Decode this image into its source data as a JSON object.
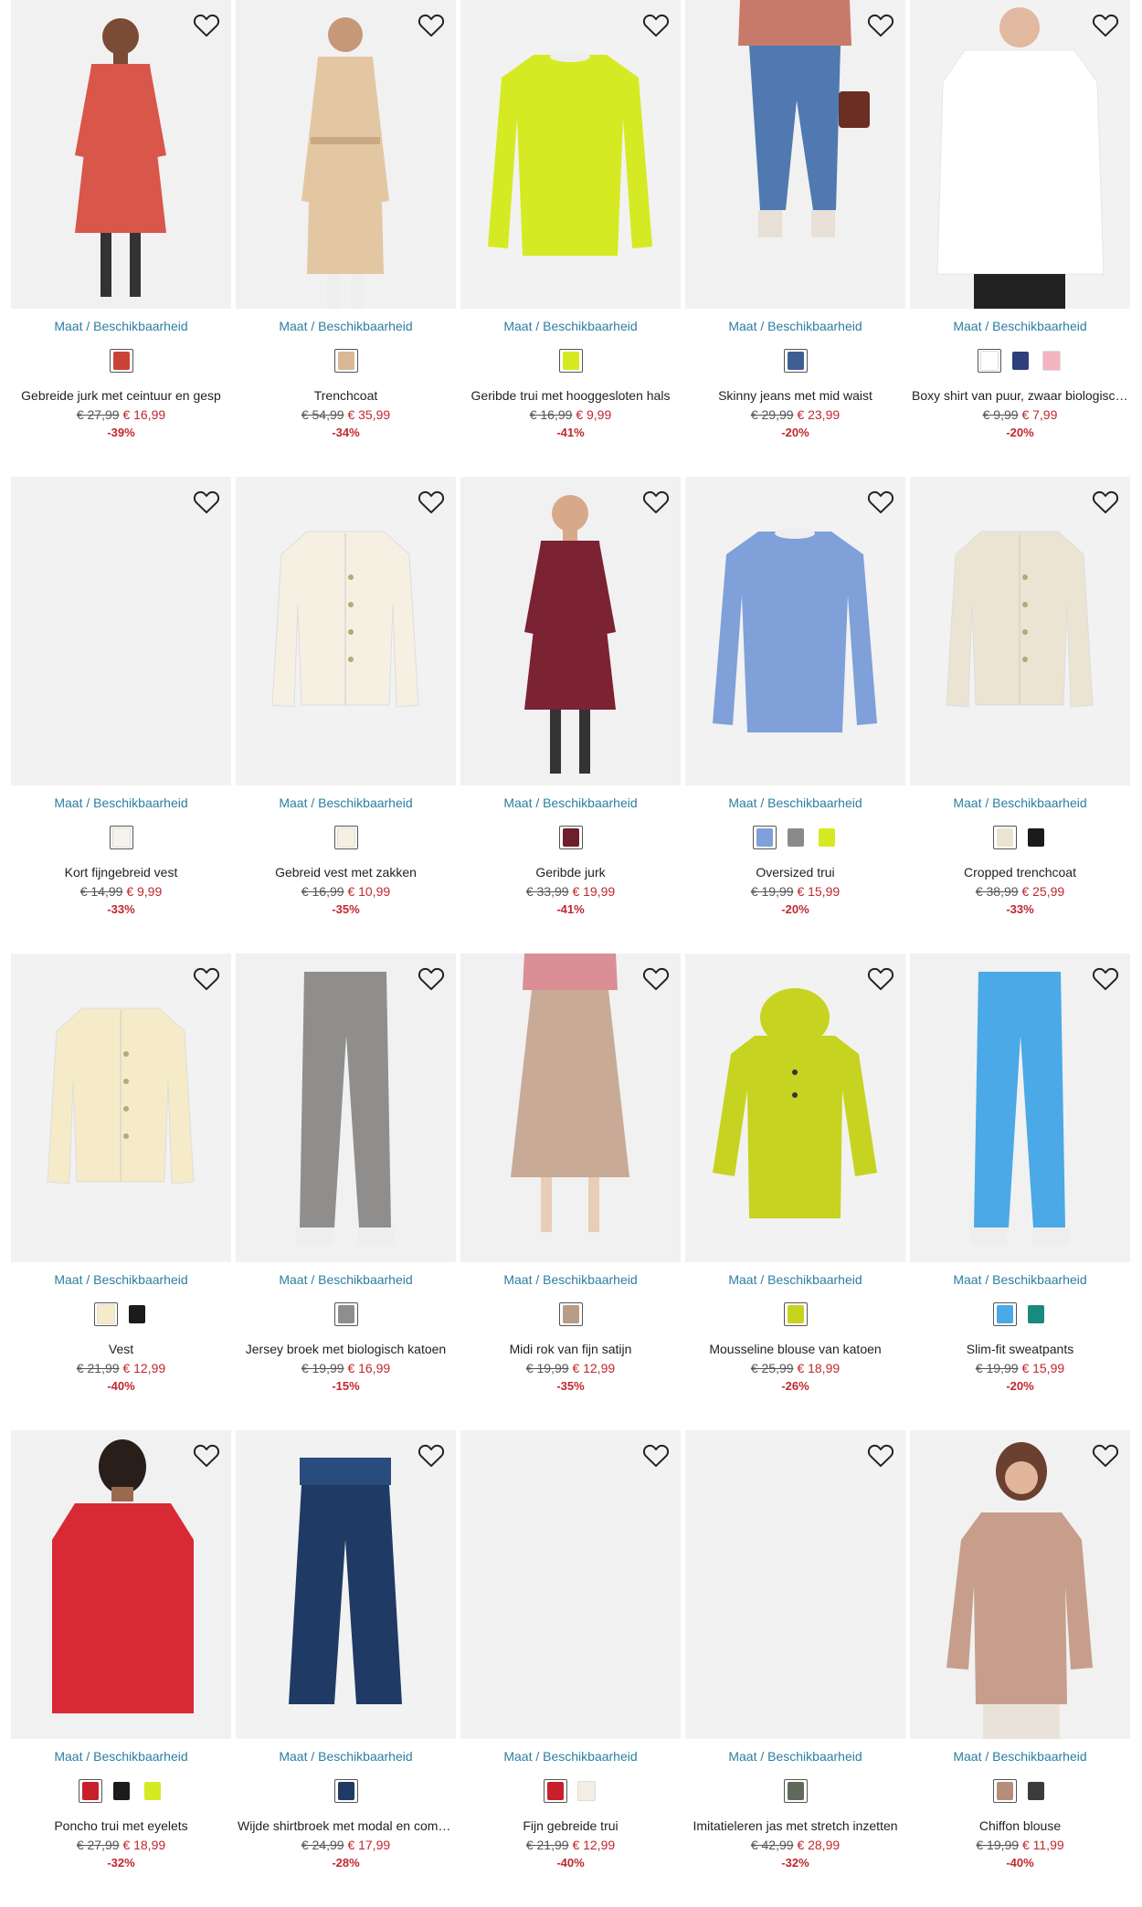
{
  "ui": {
    "maat_label": "Maat / Beschikbaarheid",
    "wishlist_icon": "heart-outline-icon"
  },
  "products": [
    {
      "name": "Gebreide jurk met ceintuur en gesp",
      "old_price": "€ 27,99",
      "new_price": "€ 16,99",
      "discount": "-39%",
      "bg": "#f1f1f1",
      "kind": "dress",
      "color": "#d9564a",
      "skin": "#7a4b35",
      "swatches": [
        "#c94436"
      ]
    },
    {
      "name": "Trenchcoat",
      "old_price": "€ 54,99",
      "new_price": "€ 35,99",
      "discount": "-34%",
      "bg": "#f1f1f1",
      "kind": "coat",
      "color": "#e3c7a3",
      "skin": "#c69878",
      "swatches": [
        "#d8b895"
      ]
    },
    {
      "name": "Geribde trui met hooggesloten hals",
      "old_price": "€ 16,99",
      "new_price": "€ 9,99",
      "discount": "-41%",
      "bg": "#f2f2f2",
      "kind": "sweater",
      "color": "#d5ea22",
      "skin": null,
      "swatches": [
        "#d5ea22"
      ]
    },
    {
      "name": "Skinny jeans met mid waist",
      "old_price": "€ 29,99",
      "new_price": "€ 23,99",
      "discount": "-20%",
      "bg": "#f1f1f1",
      "kind": "jeans",
      "color": "#4f79b0",
      "skin": "#caa085",
      "swatches": [
        "#3e5f94"
      ]
    },
    {
      "name": "Boxy shirt van puur, zwaar biologisch katoen",
      "old_price": "€ 9,99",
      "new_price": "€ 7,99",
      "discount": "-20%",
      "bg": "#f2f2f2",
      "kind": "shirt",
      "color": "#ffffff",
      "skin": "#e0b9a0",
      "swatches": [
        "#ffffff",
        "#2f3f7c",
        "#f2b4c0"
      ]
    },
    {
      "name": "Kort fijngebreid vest",
      "old_price": "€ 14,99",
      "new_price": "€ 9,99",
      "discount": "-33%",
      "bg": "#f2f2f2",
      "kind": "empty",
      "color": "#f2f2f2",
      "skin": null,
      "swatches": [
        "#f7f3ea"
      ]
    },
    {
      "name": "Gebreid vest met zakken",
      "old_price": "€ 16,99",
      "new_price": "€ 10,99",
      "discount": "-35%",
      "bg": "#f2f2f2",
      "kind": "cardigan",
      "color": "#f6f0e3",
      "skin": null,
      "swatches": [
        "#f6f0e3"
      ]
    },
    {
      "name": "Geribde jurk",
      "old_price": "€ 33,99",
      "new_price": "€ 19,99",
      "discount": "-41%",
      "bg": "#f1f1f1",
      "kind": "dress",
      "color": "#7b2233",
      "skin": "#d7a98a",
      "swatches": [
        "#6d1f2d"
      ]
    },
    {
      "name": "Oversized trui",
      "old_price": "€ 19,99",
      "new_price": "€ 15,99",
      "discount": "-20%",
      "bg": "#f2f2f2",
      "kind": "sweater",
      "color": "#7fa0d8",
      "skin": null,
      "swatches": [
        "#7fa0d8",
        "#8a8a8a",
        "#d5ea22"
      ]
    },
    {
      "name": "Cropped trenchcoat",
      "old_price": "€ 38,99",
      "new_price": "€ 25,99",
      "discount": "-33%",
      "bg": "#f2f2f2",
      "kind": "cardigan",
      "color": "#ece4d2",
      "skin": null,
      "swatches": [
        "#ece4d2",
        "#1b1b1b"
      ]
    },
    {
      "name": "Vest",
      "old_price": "€ 21,99",
      "new_price": "€ 12,99",
      "discount": "-40%",
      "bg": "#f2f2f2",
      "kind": "cardigan",
      "color": "#f5ebc8",
      "skin": null,
      "swatches": [
        "#f5ebc8",
        "#1b1b1b"
      ]
    },
    {
      "name": "Jersey broek met biologisch katoen",
      "old_price": "€ 19,99",
      "new_price": "€ 16,99",
      "discount": "-15%",
      "bg": "#f1f1f1",
      "kind": "pants",
      "color": "#8f8e8c",
      "skin": null,
      "swatches": [
        "#8f8e8c"
      ]
    },
    {
      "name": "Midi rok van fijn satijn",
      "old_price": "€ 19,99",
      "new_price": "€ 12,99",
      "discount": "-35%",
      "bg": "#f1f1f1",
      "kind": "skirt",
      "color": "#c8aa96",
      "skin": null,
      "swatches": [
        "#b89c86"
      ]
    },
    {
      "name": "Mousseline blouse van katoen",
      "old_price": "€ 25,99",
      "new_price": "€ 18,99",
      "discount": "-26%",
      "bg": "#f2f2f2",
      "kind": "hoodie",
      "color": "#c7d321",
      "skin": null,
      "swatches": [
        "#c7d321"
      ]
    },
    {
      "name": "Slim-fit sweatpants",
      "old_price": "€ 19,99",
      "new_price": "€ 15,99",
      "discount": "-20%",
      "bg": "#f1f1f1",
      "kind": "pants",
      "color": "#4aa9e6",
      "skin": null,
      "swatches": [
        "#4aa9e6",
        "#1b8a7e"
      ]
    },
    {
      "name": "Poncho trui met eyelets",
      "old_price": "€ 27,99",
      "new_price": "€ 18,99",
      "discount": "-32%",
      "bg": "#f1f1f1",
      "kind": "poncho",
      "color": "#d82a35",
      "skin": "#9a6a4e",
      "swatches": [
        "#c8202a",
        "#1b1b1b",
        "#d5ea22"
      ]
    },
    {
      "name": "Wijde shirtbroek met modal en comfortband",
      "old_price": "€ 24,99",
      "new_price": "€ 17,99",
      "discount": "-28%",
      "bg": "#f2f2f2",
      "kind": "widepants",
      "color": "#1f3a64",
      "skin": null,
      "swatches": [
        "#1f3a64"
      ]
    },
    {
      "name": "Fijn gebreide trui",
      "old_price": "€ 21,99",
      "new_price": "€ 12,99",
      "discount": "-40%",
      "bg": "#f2f2f2",
      "kind": "empty",
      "color": "#f2f2f2",
      "skin": null,
      "swatches": [
        "#c8202a",
        "#f3eee2"
      ]
    },
    {
      "name": "Imitatieleren jas met stretch inzetten",
      "old_price": "€ 42,99",
      "new_price": "€ 28,99",
      "discount": "-32%",
      "bg": "#f2f2f2",
      "kind": "empty",
      "color": "#f2f2f2",
      "skin": null,
      "swatches": [
        "#5f6b5a"
      ]
    },
    {
      "name": "Chiffon blouse",
      "old_price": "€ 19,99",
      "new_price": "€ 11,99",
      "discount": "-40%",
      "bg": "#f1f1f1",
      "kind": "blouse",
      "color": "#c79e8c",
      "skin": "#e2b69b",
      "swatches": [
        "#b58d7b",
        "#3b3b3b"
      ]
    }
  ]
}
